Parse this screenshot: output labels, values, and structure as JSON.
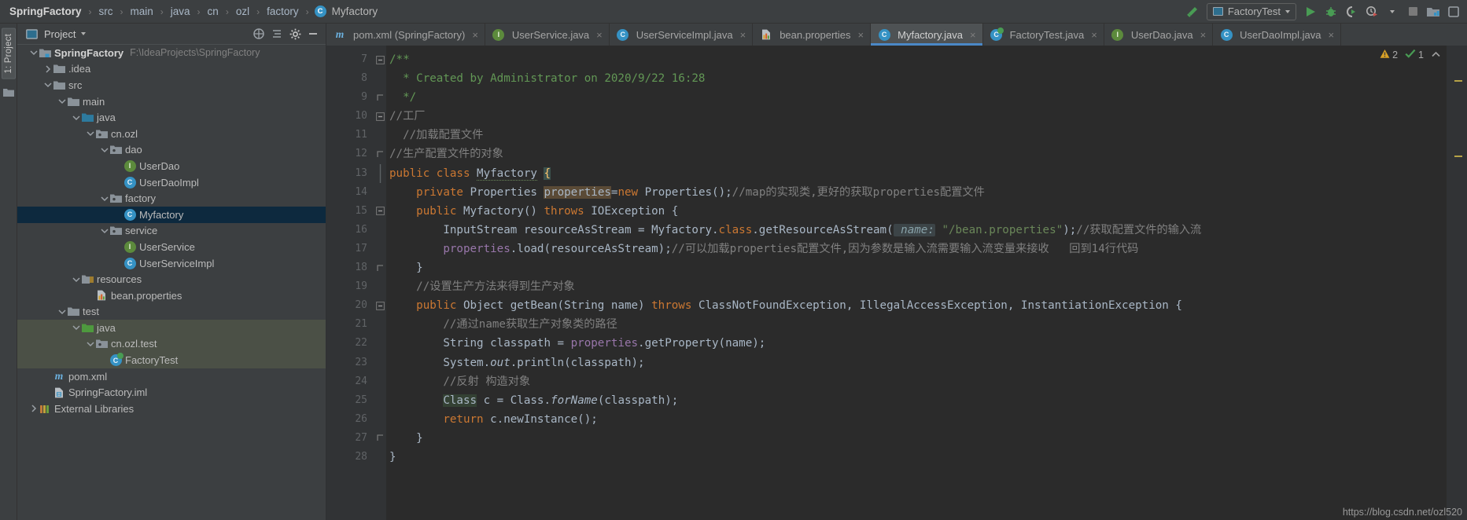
{
  "breadcrumb": {
    "root": "SpringFactory",
    "items": [
      "src",
      "main",
      "java",
      "cn",
      "ozl",
      "factory"
    ],
    "last": "Myfactory",
    "separator": "›"
  },
  "toolbar": {
    "run_config": "FactoryTest",
    "icons": [
      "build-hammer-icon",
      "run-icon",
      "debug-icon",
      "run-coverage-icon",
      "profiler-icon",
      "stop-icon",
      "open-project-icon",
      "search-everywhere-icon"
    ]
  },
  "project_panel": {
    "title": "Project",
    "header_icons": [
      "collapse-scope-icon",
      "flatten-packages-icon",
      "settings-gear-icon",
      "hide-panel-icon"
    ],
    "left_strip_label": "1: Project",
    "tree": [
      {
        "label": "SpringFactory",
        "path": "F:\\IdeaProjects\\SpringFactory",
        "indent": 0,
        "arrow": "down",
        "icon": "module-folder",
        "bold": true
      },
      {
        "label": ".idea",
        "indent": 1,
        "arrow": "right",
        "icon": "folder"
      },
      {
        "label": "src",
        "indent": 1,
        "arrow": "down",
        "icon": "folder"
      },
      {
        "label": "main",
        "indent": 2,
        "arrow": "down",
        "icon": "folder"
      },
      {
        "label": "java",
        "indent": 3,
        "arrow": "down",
        "icon": "source-folder"
      },
      {
        "label": "cn.ozl",
        "indent": 4,
        "arrow": "down",
        "icon": "package"
      },
      {
        "label": "dao",
        "indent": 5,
        "arrow": "down",
        "icon": "package"
      },
      {
        "label": "UserDao",
        "indent": 6,
        "arrow": "none",
        "icon": "interface"
      },
      {
        "label": "UserDaoImpl",
        "indent": 6,
        "arrow": "none",
        "icon": "class"
      },
      {
        "label": "factory",
        "indent": 5,
        "arrow": "down",
        "icon": "package"
      },
      {
        "label": "Myfactory",
        "indent": 6,
        "arrow": "none",
        "icon": "class",
        "selected": true
      },
      {
        "label": "service",
        "indent": 5,
        "arrow": "down",
        "icon": "package"
      },
      {
        "label": "UserService",
        "indent": 6,
        "arrow": "none",
        "icon": "interface"
      },
      {
        "label": "UserServiceImpl",
        "indent": 6,
        "arrow": "none",
        "icon": "class"
      },
      {
        "label": "resources",
        "indent": 3,
        "arrow": "down",
        "icon": "resource-folder"
      },
      {
        "label": "bean.properties",
        "indent": 4,
        "arrow": "none",
        "icon": "properties-file"
      },
      {
        "label": "test",
        "indent": 2,
        "arrow": "down",
        "icon": "folder"
      },
      {
        "label": "java",
        "indent": 3,
        "arrow": "down",
        "icon": "test-source-folder",
        "testsrc": true
      },
      {
        "label": "cn.ozl.test",
        "indent": 4,
        "arrow": "down",
        "icon": "package",
        "testsrc": true
      },
      {
        "label": "FactoryTest",
        "indent": 5,
        "arrow": "none",
        "icon": "test-class",
        "testsrc": true
      },
      {
        "label": "pom.xml",
        "indent": 1,
        "arrow": "none",
        "icon": "maven-file"
      },
      {
        "label": "SpringFactory.iml",
        "indent": 1,
        "arrow": "none",
        "icon": "iml-file"
      },
      {
        "label": "External Libraries",
        "indent": 0,
        "arrow": "right",
        "icon": "libraries"
      }
    ]
  },
  "editor": {
    "tabs": [
      {
        "label": "pom.xml (SpringFactory)",
        "icon": "maven-file",
        "active": false,
        "closable": true
      },
      {
        "label": "UserService.java",
        "icon": "interface",
        "active": false,
        "closable": true
      },
      {
        "label": "UserServiceImpl.java",
        "icon": "class",
        "active": false,
        "closable": true
      },
      {
        "label": "bean.properties",
        "icon": "properties-file",
        "active": false,
        "closable": true
      },
      {
        "label": "Myfactory.java",
        "icon": "class",
        "active": true,
        "closable": true
      },
      {
        "label": "FactoryTest.java",
        "icon": "test-class",
        "active": false,
        "closable": true
      },
      {
        "label": "UserDao.java",
        "icon": "interface",
        "active": false,
        "closable": true
      },
      {
        "label": "UserDaoImpl.java",
        "icon": "class",
        "active": false,
        "closable": true
      }
    ],
    "first_line_number": 7,
    "line_numbers": [
      7,
      8,
      9,
      10,
      11,
      12,
      13,
      14,
      15,
      16,
      17,
      18,
      19,
      20,
      21,
      22,
      23,
      24,
      25,
      26,
      27,
      28
    ],
    "inspection": {
      "warnings": "2",
      "passed": "1",
      "warning_icon": "warning-triangle-icon",
      "ok_icon": "check-icon",
      "up_icon": "chevron-up-icon"
    },
    "watermark": "https://blog.csdn.net/ozl520"
  }
}
